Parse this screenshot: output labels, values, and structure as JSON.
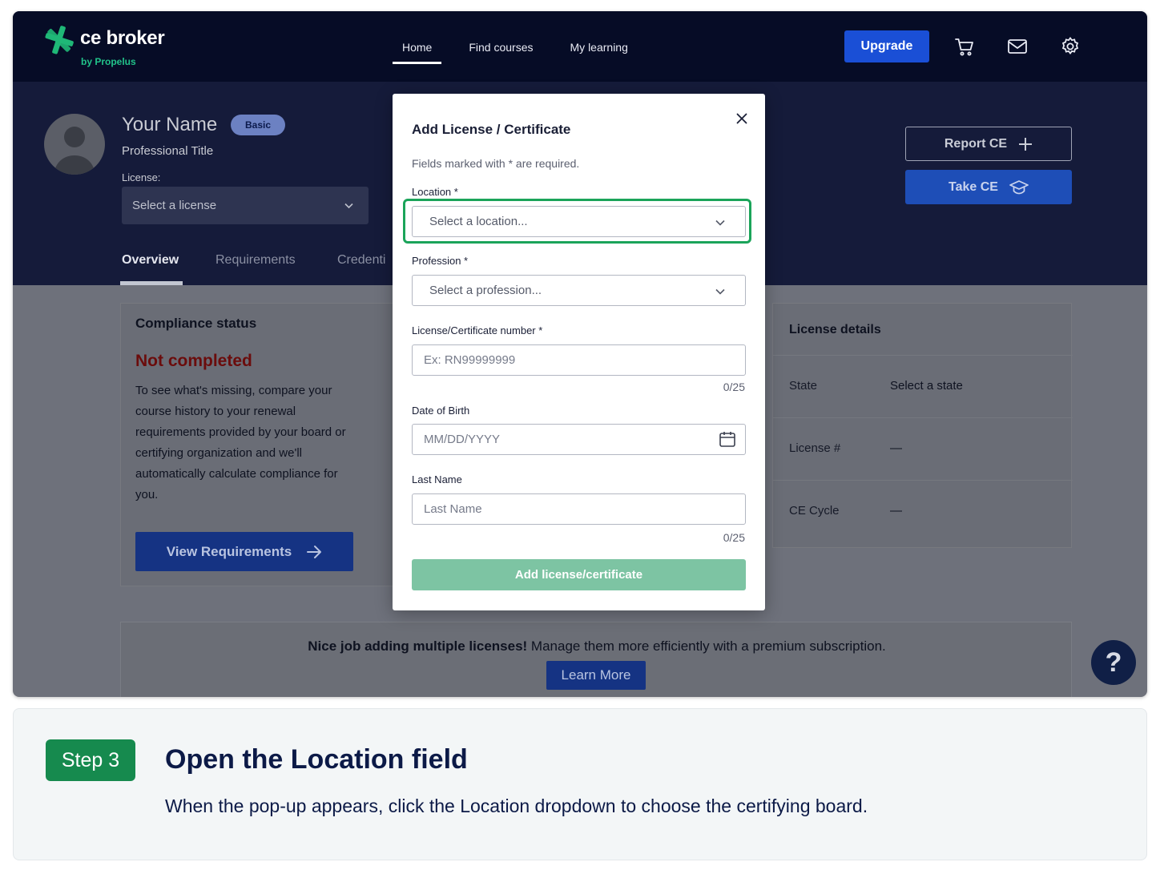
{
  "brand": {
    "name": "ce broker",
    "sub": "by Propelus",
    "colors": {
      "navy": "#060c26",
      "green": "#168a4e",
      "blue": "#1a4fd6"
    }
  },
  "nav": {
    "items": [
      {
        "label": "Home",
        "active": true
      },
      {
        "label": "Find courses",
        "active": false
      },
      {
        "label": "My learning",
        "active": false
      }
    ],
    "upgrade_label": "Upgrade",
    "icons": [
      "cart-icon",
      "mail-icon",
      "gear-icon"
    ]
  },
  "profile": {
    "name": "Your Name",
    "badge": "Basic",
    "title": "Professional Title",
    "license_label": "License:",
    "license_placeholder": "Select a license",
    "tabs": [
      "Overview",
      "Requirements",
      "Credenti"
    ],
    "active_tab": "Overview"
  },
  "actions": {
    "report_label": "Report CE",
    "take_label": "Take CE"
  },
  "compliance": {
    "title": "Compliance status",
    "status": "Not completed",
    "body": "To see what's missing, compare your course history to your renewal requirements provided by your board or certifying organization and we'll automatically calculate compliance for you.",
    "button_label": "View Requirements"
  },
  "license_details": {
    "title": "License details",
    "rows": [
      {
        "label": "State",
        "value": "Select a state"
      },
      {
        "label": "License #",
        "value": "—"
      },
      {
        "label": "CE Cycle",
        "value": "—"
      }
    ]
  },
  "banner": {
    "bold": "Nice job adding multiple licenses!",
    "text": " Manage them more efficiently with a premium subscription.",
    "button_label": "Learn More"
  },
  "help": {
    "label": "?"
  },
  "modal": {
    "title": "Add License / Certificate",
    "note": "Fields marked with * are required.",
    "location_label": "Location *",
    "location_placeholder": "Select a location...",
    "profession_label": "Profession *",
    "profession_placeholder": "Select a profession...",
    "number_label": "License/Certificate number *",
    "number_placeholder": "Ex: RN99999999",
    "number_counter": "0/25",
    "dob_label": "Date of Birth",
    "dob_placeholder": "MM/DD/YYYY",
    "last_name_label": "Last Name",
    "last_name_placeholder": "Last Name",
    "last_name_counter": "0/25",
    "submit_label": "Add license/certificate"
  },
  "step": {
    "pill": "Step 3",
    "title": "Open the Location field",
    "description": "When the pop-up appears, click the Location dropdown to choose the certifying board."
  }
}
